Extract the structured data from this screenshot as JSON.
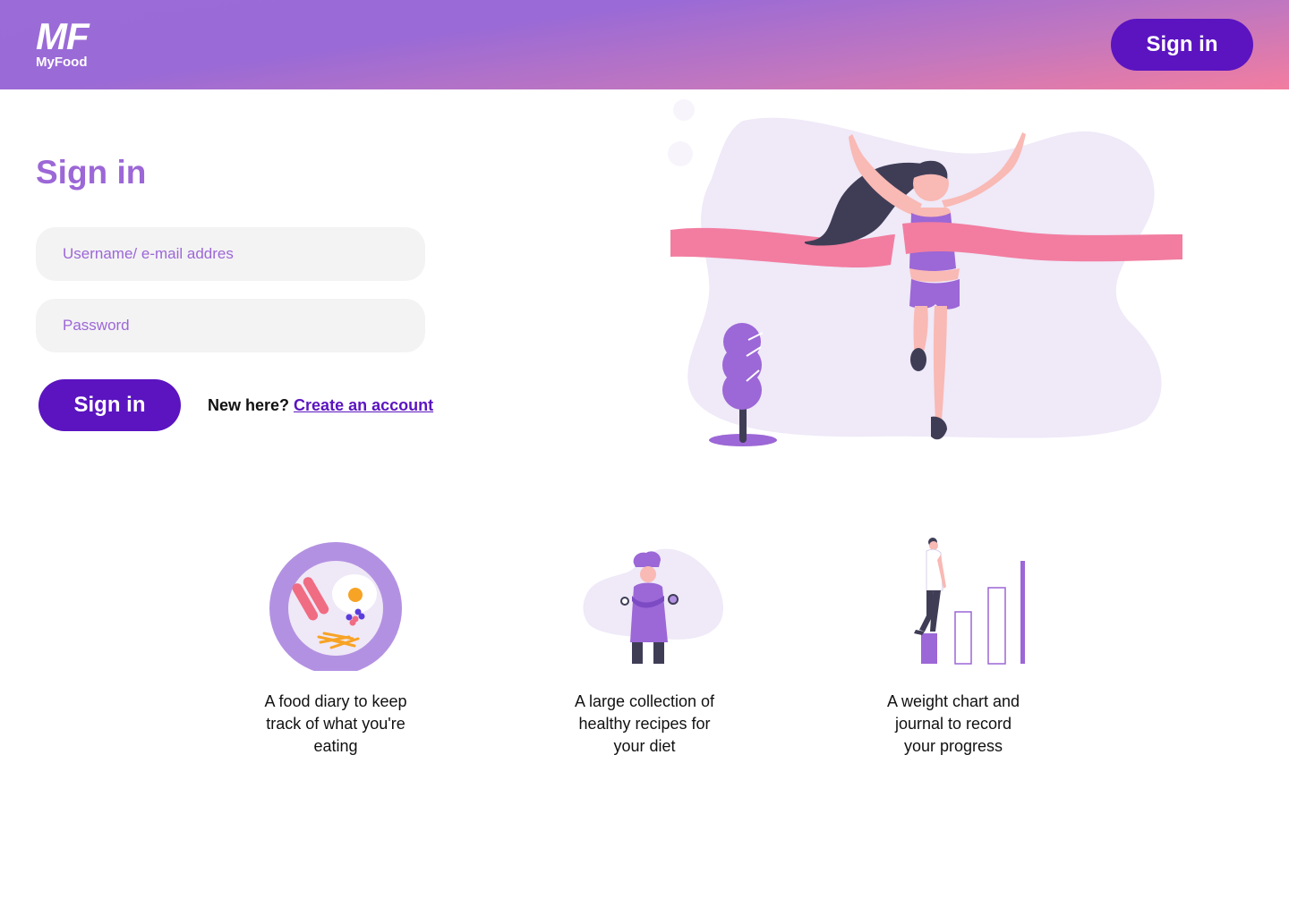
{
  "header": {
    "logo_mark": "MF",
    "logo_name": "MyFood",
    "signin_label": "Sign in"
  },
  "form": {
    "title": "Sign in",
    "username_placeholder": "Username/ e-mail addres",
    "password_placeholder": "Password",
    "submit_label": "Sign in",
    "new_here_text": "New here?",
    "create_account_link": "Create an account"
  },
  "features": [
    {
      "text": "A food diary to keep track of what you're eating",
      "icon": "food-plate-icon"
    },
    {
      "text": "A large collection of healthy recipes for your diet",
      "icon": "chef-icon"
    },
    {
      "text": "A weight chart and journal to record your progress",
      "icon": "progress-chart-icon"
    }
  ],
  "colors": {
    "brand_purple": "#5b14c0",
    "accent_purple": "#9c67d6",
    "accent_pink": "#f27da0",
    "input_bg": "#f3f3f4"
  }
}
